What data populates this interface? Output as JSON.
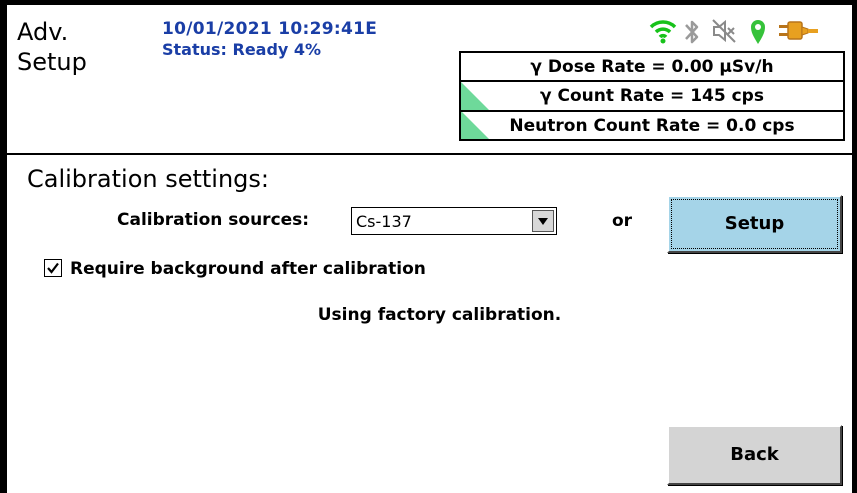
{
  "header": {
    "title_line1": "Adv.",
    "title_line2": "Setup",
    "datetime": "10/01/2021 10:29:41E",
    "status": "Status: Ready 4%",
    "icons": [
      "wifi-icon",
      "bluetooth-icon",
      "speaker-muted-icon",
      "location-pin-icon",
      "power-plug-icon"
    ],
    "colors": {
      "text_blue": "#1a3ea6",
      "wifi_green": "#17c21a",
      "pin_green": "#36c23a",
      "plug_orange": "#e8a020",
      "indicator_green": "#6ed99a"
    }
  },
  "readings": [
    {
      "label": "γ Dose Rate = 0.00  µSv/h",
      "indicator": false
    },
    {
      "label": "γ Count Rate = 145 cps",
      "indicator": true
    },
    {
      "label": "Neutron Count Rate = 0.0 cps",
      "indicator": true
    }
  ],
  "calibration": {
    "section_title": "Calibration settings:",
    "sources_label": "Calibration sources:",
    "sources_value": "Cs-137",
    "or_label": "or",
    "setup_button": "Setup",
    "checkbox_label": "Require background after calibration",
    "checkbox_checked": true,
    "status_text": "Using factory calibration."
  },
  "footer": {
    "back_button": "Back",
    "button_colors": {
      "setup": "#a5d4e8",
      "back": "#d4d4d4"
    }
  }
}
